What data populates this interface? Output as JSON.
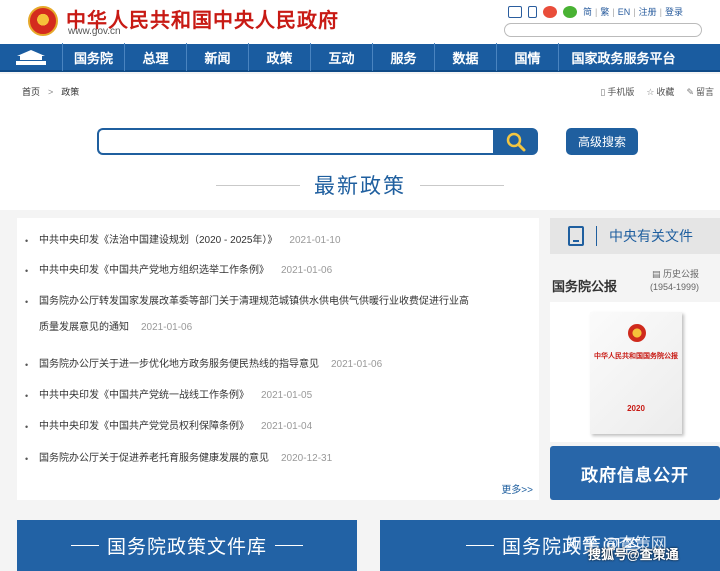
{
  "header": {
    "title": "中华人民共和国中央人民政府",
    "url": "www.gov.cn",
    "links": [
      "简",
      "繁",
      "EN",
      "注册",
      "登录"
    ]
  },
  "nav": {
    "items": [
      "国务院",
      "总理",
      "新闻",
      "政策",
      "互动",
      "服务",
      "数据",
      "国情",
      "国家政务服务平台"
    ]
  },
  "breadcrumb": {
    "home": "首页",
    "current": "政策"
  },
  "utilities": {
    "mobile": "手机版",
    "favorite": "收藏",
    "message": "留言"
  },
  "search": {
    "placeholder": "",
    "advanced_label": "高级搜索"
  },
  "section": {
    "title": "最新政策"
  },
  "policies": [
    {
      "title": "中共中央印发《法治中国建设规划（2020 - 2025年）》",
      "date": "2021-01-10"
    },
    {
      "title": "中共中央印发《中国共产党地方组织选举工作条例》",
      "date": "2021-01-06"
    },
    {
      "title": "国务院办公厅转发国家发展改革委等部门关于清理规范城镇供水供电供气供暖行业收费促进行业高",
      "title2": "质量发展意见的通知",
      "date": "2021-01-06"
    },
    {
      "title": "国务院办公厅关于进一步优化地方政务服务便民热线的指导意见",
      "date": "2021-01-06"
    },
    {
      "title": "中共中央印发《中国共产党统一战线工作条例》",
      "date": "2021-01-05"
    },
    {
      "title": "中共中央印发《中国共产党党员权利保障条例》",
      "date": "2021-01-04"
    },
    {
      "title": "国务院办公厅关于促进养老托育服务健康发展的意见",
      "date": "2020-12-31"
    }
  ],
  "more_label": "更多>>",
  "sidebar": {
    "central_docs": "中央有关文件",
    "gazette_title": "国务院公报",
    "history_label": "历史公报",
    "history_range": "(1954-1999)",
    "book_title": "中华人民共和国国务院公报",
    "book_year": "2020",
    "info_open": "政府信息公开"
  },
  "banners": {
    "left": "国务院政策文件库",
    "right": "国务院政策问答"
  },
  "watermarks": {
    "zhihu": "知乎 @查策网",
    "sohu": "搜狐号@查策通"
  },
  "colors": {
    "brand_red": "#c81a14",
    "nav_blue": "#1a5ca0",
    "accent_blue": "#1f5f9f"
  }
}
